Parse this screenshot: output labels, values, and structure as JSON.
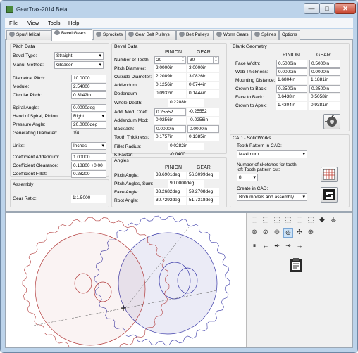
{
  "window": {
    "title": "GearTrax-2014 Beta",
    "min": "—",
    "max": "□",
    "close": "✕"
  },
  "menu": [
    "File",
    "View",
    "Tools",
    "Help"
  ],
  "tabs": [
    "Spur/Helical",
    "Bevel Gears",
    "Sprockets",
    "Gear Belt Pulleys",
    "Belt Pulleys",
    "Worm Gears",
    "Splines",
    "Options"
  ],
  "pitch": {
    "title": "Pitch Data",
    "bevel_type_label": "Bevel Type:",
    "bevel_type": "Straight",
    "manu_label": "Manu. Method:",
    "manu": "Gleason",
    "dp_label": "Diametral Pitch:",
    "dp": "10.0000",
    "module_label": "Module:",
    "module": "2.54000",
    "cp_label": "Circular Pitch:",
    "cp": "0.3142in",
    "spiral_label": "Spiral Angle:",
    "spiral": "0.0000deg",
    "hand_label": "Hand of Spiral, Pinion:",
    "hand": "Right",
    "pa_label": "Pressure Angle:",
    "pa": "20.0000deg",
    "gd_label": "Generating Diameter:",
    "gd": "n/a",
    "units_label": "Units:",
    "units": "Inches",
    "ca_label": "Coefficient Addendum:",
    "ca": "1.00000",
    "cc_label": "Coefficient Clearance:",
    "cc": "0.18800 +0.00",
    "cf_label": "Coefficient Fillet:",
    "cf": "0.28200"
  },
  "assembly": {
    "title": "Assembly",
    "ratio_label": "Gear Ratio:",
    "ratio": "1:1.5000"
  },
  "bevel": {
    "title": "Bevel Data",
    "pinion": "PINION",
    "gear": "GEAR",
    "rows": [
      {
        "label": "Number of Teeth:",
        "p": "20",
        "g": "30"
      },
      {
        "label": "Pitch Diameter:",
        "p": "2.0000in",
        "g": "3.0000in"
      },
      {
        "label": "Outside Diameter:",
        "p": "2.2089in",
        "g": "3.0826in"
      },
      {
        "label": "Addendum",
        "p": "0.1256in",
        "g": "0.0744in"
      },
      {
        "label": "Dedendum",
        "p": "0.0932in",
        "g": "0.1444in"
      }
    ],
    "whole_depth_label": "Whole Depth:",
    "whole_depth": "0.2208in",
    "rows2": [
      {
        "label": "Add. Mod. Coef:",
        "p": "0.25552",
        "g": "-0.25552"
      },
      {
        "label": "Addendum Mod:",
        "p": "0.0256in",
        "g": "-0.0256in"
      },
      {
        "label": "Backlash:",
        "p": "0.0000in",
        "g": "0.0000in"
      },
      {
        "label": "Tooth Thickness:",
        "p": "0.1757in",
        "g": "0.1385in"
      }
    ],
    "fillet_label": "Fillet Radius:",
    "fillet": "0.0282in",
    "k_label": "K Factor:",
    "k": "-0.0400"
  },
  "angles": {
    "title": "Angles",
    "pinion": "PINION",
    "gear": "GEAR",
    "pitch_label": "Pitch Angle:",
    "pitch_p": "33.6901deg",
    "pitch_g": "56.3099deg",
    "sum_label": "Pitch Angles, Sum:",
    "sum": "90.0000deg",
    "face_label": "Face Angle:",
    "face_p": "38.2682deg",
    "face_g": "59.2708deg",
    "root_label": "Root Angle:",
    "root_p": "30.7292deg",
    "root_g": "51.7318deg"
  },
  "blank": {
    "title": "Blank Geometry",
    "pinion": "PINION",
    "gear": "GEAR",
    "rows": [
      {
        "label": "Face Width:",
        "p": "0.5000in",
        "g": "0.5000in"
      },
      {
        "label": "Web Thickness:",
        "p": "0.0000in",
        "g": "0.0000in"
      },
      {
        "label": "Mounting Distance:",
        "p": "1.6804in",
        "g": "1.1881in"
      },
      {
        "label": "Crown to Back:",
        "p": "0.2500in",
        "g": "0.2500in"
      },
      {
        "label": "Face to Back:",
        "p": "0.6438in",
        "g": "0.5058in"
      },
      {
        "label": "Crown to Apex:",
        "p": "1.4304in",
        "g": "0.9381in"
      }
    ]
  },
  "cad": {
    "title": "CAD - SolidWorks",
    "tooth_label": "Tooth Pattern in CAD:",
    "tooth": "Maximum",
    "sketch_label1": "Number of sketches for tooth",
    "sketch_label2": "loft Tooth pattern cut:",
    "sketch": "8",
    "create_label": "Create in CAD:",
    "create": "Both models and assembly"
  },
  "colors": {
    "pinion": "#b23a3a",
    "gear": "#3a3aa8",
    "accent": "#2f6fb5"
  }
}
